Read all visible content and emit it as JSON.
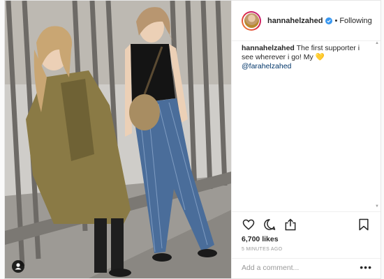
{
  "post": {
    "username": "hannahelzahed",
    "follow_separator": "•",
    "follow_status": "Following",
    "caption_username": "hannahelzahed",
    "caption_text": "The first supporter i see wherever i go! My 💛",
    "caption_mention": "@farahelzahed",
    "likes": "6,700 likes",
    "time_ago": "5 MINUTES AGO",
    "comment_placeholder": "Add a comment...",
    "more_label": "•••"
  },
  "colors": {
    "verified": "#3897f0",
    "mention": "#003569",
    "text": "#262626",
    "muted": "#999999"
  },
  "icons": [
    "heart-icon",
    "comment-icon",
    "share-icon",
    "bookmark-icon",
    "verified-icon",
    "user-tag-icon"
  ]
}
